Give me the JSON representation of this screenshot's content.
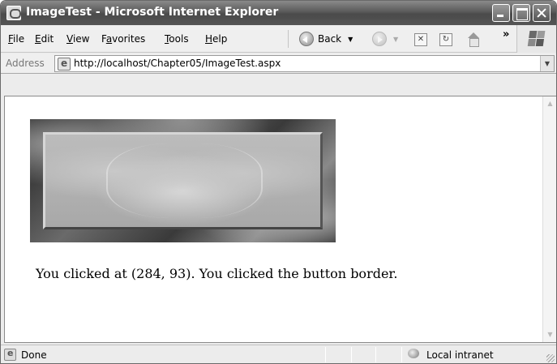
{
  "window": {
    "title": "ImageTest - Microsoft Internet Explorer"
  },
  "menu": {
    "items": [
      {
        "key": "F",
        "rest": "ile"
      },
      {
        "key": "E",
        "rest": "dit"
      },
      {
        "key": "V",
        "rest": "iew"
      },
      {
        "key": "a",
        "pre": "F",
        "rest": "vorites"
      },
      {
        "key": "T",
        "rest": "ools"
      },
      {
        "key": "H",
        "rest": "elp"
      }
    ]
  },
  "toolbar": {
    "back_label": "Back",
    "more_glyph": "»"
  },
  "address": {
    "label": "Address",
    "url": "http://localhost/Chapter05/ImageTest.aspx"
  },
  "page": {
    "result_text": "You clicked at (284, 93). You clicked the button border."
  },
  "status": {
    "text": "Done",
    "zone": "Local intranet"
  }
}
